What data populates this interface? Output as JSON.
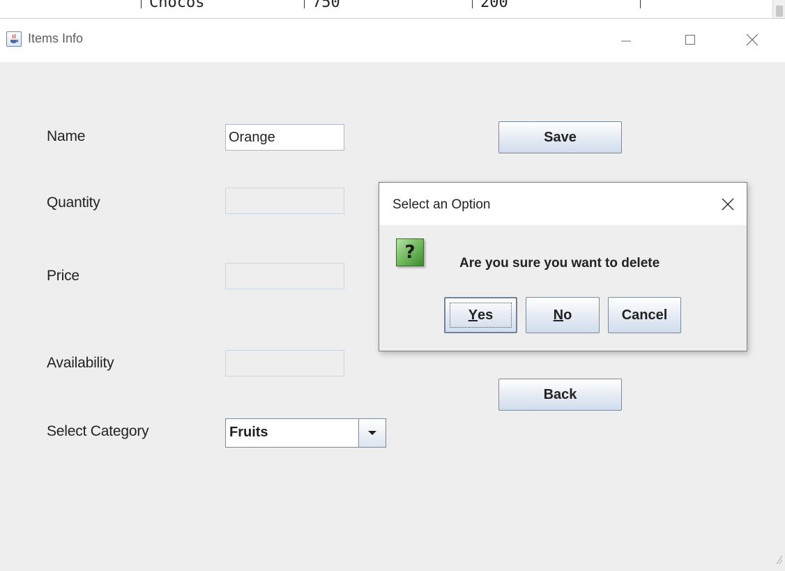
{
  "background_table": {
    "cells": [
      "Chocos",
      "750",
      "200"
    ]
  },
  "window": {
    "title": "Items Info",
    "controls": {
      "minimize_icon": "minimize-icon",
      "maximize_icon": "maximize-icon",
      "close_icon": "close-icon"
    }
  },
  "form": {
    "name_label": "Name",
    "name_value": "Orange",
    "quantity_label": "Quantity",
    "quantity_value": "",
    "price_label": "Price",
    "price_value": "",
    "availability_label": "Availability",
    "availability_value": "",
    "category_label": "Select Category",
    "category_selected": "Fruits"
  },
  "buttons": {
    "save": "Save",
    "back": "Back"
  },
  "dialog": {
    "title": "Select an Option",
    "message": "Are you sure you want to delete",
    "icon": "question-icon",
    "icon_glyph": "?",
    "yes_mnemonic": "Y",
    "yes_rest": "es",
    "no_mnemonic": "N",
    "no_rest": "o",
    "cancel": "Cancel"
  },
  "colors": {
    "window_bg": "#eeeeee",
    "titlebar_bg": "#ffffff",
    "button_border": "#7a8a99",
    "question_icon_green": "#6cb55a"
  }
}
